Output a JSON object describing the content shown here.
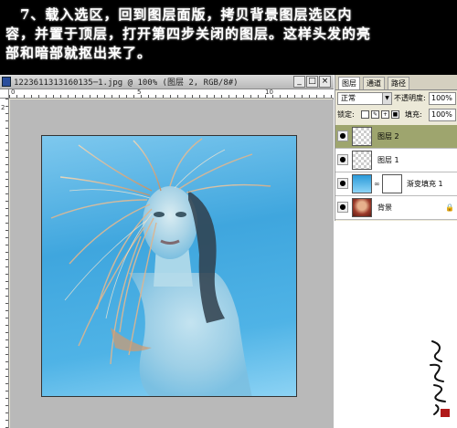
{
  "caption": {
    "line1": "　7、载入选区，回到图层面版，拷贝背景图层选区内",
    "line2": "容，并置于顶层，打开第四步关闭的图层。这样头发的亮",
    "line3": "部和暗部就抠出来了。"
  },
  "document": {
    "title": "1223611313160135─1.jpg @ 100% (图层 2, RGB/8#)",
    "ruler_h_labels": [
      "0",
      "5",
      "10"
    ],
    "ruler_v_labels": [
      "2"
    ],
    "buttons": {
      "minimize": "_",
      "maximize": "□",
      "close": "×"
    }
  },
  "layers_panel": {
    "tabs": [
      "图层",
      "通道",
      "路径"
    ],
    "active_tab": "图层",
    "blend_mode": "正常",
    "opacity_label": "不透明度:",
    "opacity_value": "100%",
    "lock_label": "锁定:",
    "fill_label": "填充:",
    "fill_value": "100%",
    "layers": [
      {
        "name": "图层 2",
        "thumb": "transparent",
        "selected": true
      },
      {
        "name": "图层 1",
        "thumb": "transparent",
        "selected": false
      },
      {
        "name": "渐变填充 1",
        "thumb": "gradient",
        "selected": false,
        "has_mask": true
      },
      {
        "name": "背景",
        "thumb": "photo",
        "selected": false,
        "locked": true
      }
    ]
  },
  "colors": {
    "selected_layer": "#9ea56e",
    "picture_blue": "#3fa6de"
  }
}
